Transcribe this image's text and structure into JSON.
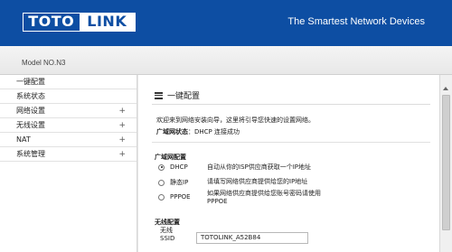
{
  "header": {
    "logo_left": "TOTO",
    "logo_right": "LINK",
    "tagline": "The Smartest Network Devices",
    "brand_color": "#0d4ea3"
  },
  "model": "Model NO.N3",
  "sidebar": {
    "items": [
      {
        "label": "一键配置",
        "expandable": false
      },
      {
        "label": "系统状态",
        "expandable": false
      },
      {
        "label": "网络设置",
        "expandable": true
      },
      {
        "label": "无线设置",
        "expandable": true
      },
      {
        "label": "NAT",
        "expandable": true
      },
      {
        "label": "系统管理",
        "expandable": true
      }
    ],
    "expand_symbol": "+"
  },
  "main": {
    "title": "一键配置",
    "title_icon": "list-icon",
    "intro": "欢迎来到网络安装向导，这里将引导您快速的设置网络。",
    "wan_status_label": "广域网状态",
    "wan_status_value": "DHCP 连接成功",
    "wan_config_heading": "广域网配置",
    "wan_modes": [
      {
        "label": "DHCP",
        "checked": true,
        "desc_lines": [
          "自动从你的ISP供应商获取一个IP地址"
        ]
      },
      {
        "label": "静态IP",
        "checked": false,
        "desc_lines": [
          "请填写网络供应商提供给您的IP地址"
        ]
      },
      {
        "label": "PPPOE",
        "checked": false,
        "desc_lines": [
          "如果网络供应商提供给您账号密码请使用",
          "PPPOE"
        ]
      }
    ],
    "wireless_heading": "无线配置",
    "ssid_label_line1": "无线",
    "ssid_label_line2": "SSID",
    "ssid_value": "TOTOLINK_A52B84"
  }
}
